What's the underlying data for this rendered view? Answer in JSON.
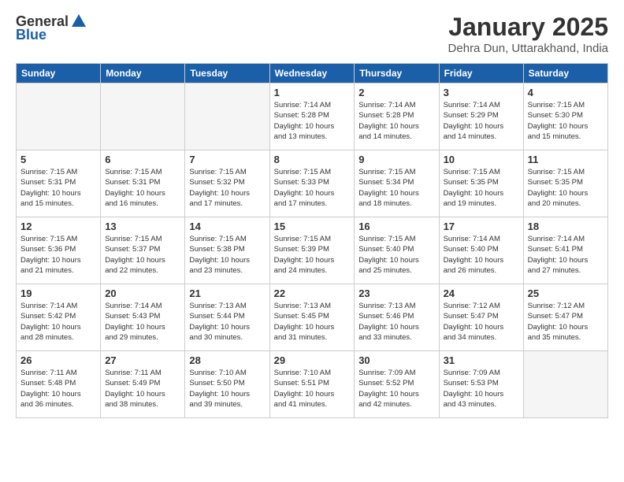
{
  "header": {
    "logo_general": "General",
    "logo_blue": "Blue",
    "month_title": "January 2025",
    "location": "Dehra Dun, Uttarakhand, India"
  },
  "weekdays": [
    "Sunday",
    "Monday",
    "Tuesday",
    "Wednesday",
    "Thursday",
    "Friday",
    "Saturday"
  ],
  "weeks": [
    [
      {
        "day": "",
        "info": ""
      },
      {
        "day": "",
        "info": ""
      },
      {
        "day": "",
        "info": ""
      },
      {
        "day": "1",
        "info": "Sunrise: 7:14 AM\nSunset: 5:28 PM\nDaylight: 10 hours\nand 13 minutes."
      },
      {
        "day": "2",
        "info": "Sunrise: 7:14 AM\nSunset: 5:28 PM\nDaylight: 10 hours\nand 14 minutes."
      },
      {
        "day": "3",
        "info": "Sunrise: 7:14 AM\nSunset: 5:29 PM\nDaylight: 10 hours\nand 14 minutes."
      },
      {
        "day": "4",
        "info": "Sunrise: 7:15 AM\nSunset: 5:30 PM\nDaylight: 10 hours\nand 15 minutes."
      }
    ],
    [
      {
        "day": "5",
        "info": "Sunrise: 7:15 AM\nSunset: 5:31 PM\nDaylight: 10 hours\nand 15 minutes."
      },
      {
        "day": "6",
        "info": "Sunrise: 7:15 AM\nSunset: 5:31 PM\nDaylight: 10 hours\nand 16 minutes."
      },
      {
        "day": "7",
        "info": "Sunrise: 7:15 AM\nSunset: 5:32 PM\nDaylight: 10 hours\nand 17 minutes."
      },
      {
        "day": "8",
        "info": "Sunrise: 7:15 AM\nSunset: 5:33 PM\nDaylight: 10 hours\nand 17 minutes."
      },
      {
        "day": "9",
        "info": "Sunrise: 7:15 AM\nSunset: 5:34 PM\nDaylight: 10 hours\nand 18 minutes."
      },
      {
        "day": "10",
        "info": "Sunrise: 7:15 AM\nSunset: 5:35 PM\nDaylight: 10 hours\nand 19 minutes."
      },
      {
        "day": "11",
        "info": "Sunrise: 7:15 AM\nSunset: 5:35 PM\nDaylight: 10 hours\nand 20 minutes."
      }
    ],
    [
      {
        "day": "12",
        "info": "Sunrise: 7:15 AM\nSunset: 5:36 PM\nDaylight: 10 hours\nand 21 minutes."
      },
      {
        "day": "13",
        "info": "Sunrise: 7:15 AM\nSunset: 5:37 PM\nDaylight: 10 hours\nand 22 minutes."
      },
      {
        "day": "14",
        "info": "Sunrise: 7:15 AM\nSunset: 5:38 PM\nDaylight: 10 hours\nand 23 minutes."
      },
      {
        "day": "15",
        "info": "Sunrise: 7:15 AM\nSunset: 5:39 PM\nDaylight: 10 hours\nand 24 minutes."
      },
      {
        "day": "16",
        "info": "Sunrise: 7:15 AM\nSunset: 5:40 PM\nDaylight: 10 hours\nand 25 minutes."
      },
      {
        "day": "17",
        "info": "Sunrise: 7:14 AM\nSunset: 5:40 PM\nDaylight: 10 hours\nand 26 minutes."
      },
      {
        "day": "18",
        "info": "Sunrise: 7:14 AM\nSunset: 5:41 PM\nDaylight: 10 hours\nand 27 minutes."
      }
    ],
    [
      {
        "day": "19",
        "info": "Sunrise: 7:14 AM\nSunset: 5:42 PM\nDaylight: 10 hours\nand 28 minutes."
      },
      {
        "day": "20",
        "info": "Sunrise: 7:14 AM\nSunset: 5:43 PM\nDaylight: 10 hours\nand 29 minutes."
      },
      {
        "day": "21",
        "info": "Sunrise: 7:13 AM\nSunset: 5:44 PM\nDaylight: 10 hours\nand 30 minutes."
      },
      {
        "day": "22",
        "info": "Sunrise: 7:13 AM\nSunset: 5:45 PM\nDaylight: 10 hours\nand 31 minutes."
      },
      {
        "day": "23",
        "info": "Sunrise: 7:13 AM\nSunset: 5:46 PM\nDaylight: 10 hours\nand 33 minutes."
      },
      {
        "day": "24",
        "info": "Sunrise: 7:12 AM\nSunset: 5:47 PM\nDaylight: 10 hours\nand 34 minutes."
      },
      {
        "day": "25",
        "info": "Sunrise: 7:12 AM\nSunset: 5:47 PM\nDaylight: 10 hours\nand 35 minutes."
      }
    ],
    [
      {
        "day": "26",
        "info": "Sunrise: 7:11 AM\nSunset: 5:48 PM\nDaylight: 10 hours\nand 36 minutes."
      },
      {
        "day": "27",
        "info": "Sunrise: 7:11 AM\nSunset: 5:49 PM\nDaylight: 10 hours\nand 38 minutes."
      },
      {
        "day": "28",
        "info": "Sunrise: 7:10 AM\nSunset: 5:50 PM\nDaylight: 10 hours\nand 39 minutes."
      },
      {
        "day": "29",
        "info": "Sunrise: 7:10 AM\nSunset: 5:51 PM\nDaylight: 10 hours\nand 41 minutes."
      },
      {
        "day": "30",
        "info": "Sunrise: 7:09 AM\nSunset: 5:52 PM\nDaylight: 10 hours\nand 42 minutes."
      },
      {
        "day": "31",
        "info": "Sunrise: 7:09 AM\nSunset: 5:53 PM\nDaylight: 10 hours\nand 43 minutes."
      },
      {
        "day": "",
        "info": ""
      }
    ]
  ]
}
